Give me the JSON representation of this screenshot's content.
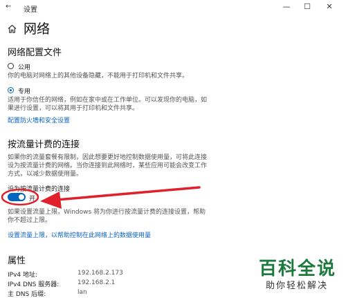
{
  "window": {
    "title": "设置",
    "minimize_glyph": "—",
    "maximize_glyph": "☐",
    "close_glyph": "✕"
  },
  "page": {
    "back_glyph": "←",
    "home_icon": "home-icon",
    "title": "网络"
  },
  "profile": {
    "heading": "网络配置文件",
    "public": {
      "label": "公用",
      "description": "你的电脑对网络上的其他设备隐藏，不能用于打印机和文件共享。",
      "selected": false
    },
    "private": {
      "label": "专用",
      "description_line1": "适用于你信任的网络，例如在家中或在工作单位。可以发现你的电脑，如",
      "description_line2": "果进行设置，可以将其用于打印机和文件共享。",
      "selected": true
    },
    "firewall_link": "配置防火墙和安全设置"
  },
  "metered": {
    "heading": "按流量计费的连接",
    "description_line1": "如果你的流量套餐有限制，因此想要更好地控制数据使用量，可将此连接",
    "description_line2": "设为按流量计费的网络。当你连接到此网络时，某些应用可能会改变工作",
    "description_line3": "方式，以减少数据使用量。",
    "toggle_label": "设为按流量计费的连接",
    "toggle_state": "开",
    "toggle_on": true,
    "limit_line1": "如果设置流量上限，Windows 将为你进行按流量计费的连接设置，帮助",
    "limit_line2": "你不超过上限。",
    "limit_link": "设置流量上限，以帮助控制在此网络上的数据使用量"
  },
  "properties": {
    "heading": "属性",
    "rows": [
      {
        "label": "IPv4 地址:",
        "value": "192.168.2.173"
      },
      {
        "label": "IPv4 DNS 服务器:",
        "value": "192.168.2.1"
      },
      {
        "label": "主 DNS 后缀:",
        "value": "lan"
      }
    ]
  },
  "annotation": {
    "arrow_color": "#e0202a"
  },
  "watermark": {
    "title": "百科全说",
    "subtitle": "助你轻松解决"
  },
  "colors": {
    "accent": "#0067c0",
    "link": "#0b62c4",
    "watermark_green": "#1c7a3c"
  }
}
